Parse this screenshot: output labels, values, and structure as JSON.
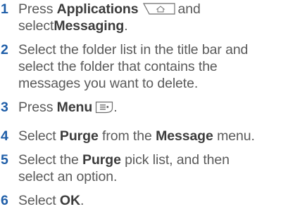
{
  "steps": [
    {
      "num": "1",
      "t1": "Press ",
      "b1": "Applications",
      "icon": "applications-button-icon",
      "t2": "and",
      "t3": "select",
      "b2": "Messaging",
      "t4": "."
    },
    {
      "num": "2",
      "t1": "Select the folder list in the title bar and",
      "t2": "select the folder that contains the",
      "t3": "messages you want to delete."
    },
    {
      "num": "3",
      "t1": "Press ",
      "b1": "Menu",
      "icon": "menu-button-icon",
      "t2": "."
    },
    {
      "num": "4",
      "t1": "Select ",
      "b1": "Purge",
      "t2": " from the ",
      "b2": "Message",
      "t3": " menu."
    },
    {
      "num": "5",
      "t1": "Select the ",
      "b1": "Purge",
      "t2": " pick list, and then",
      "t3": "select an option."
    },
    {
      "num": "6",
      "t1": "Select ",
      "b1": "OK",
      "t2": "."
    }
  ],
  "colors": {
    "number": "#1f5ea8",
    "text": "#5a5a5a",
    "bold": "#3c3c3c"
  }
}
